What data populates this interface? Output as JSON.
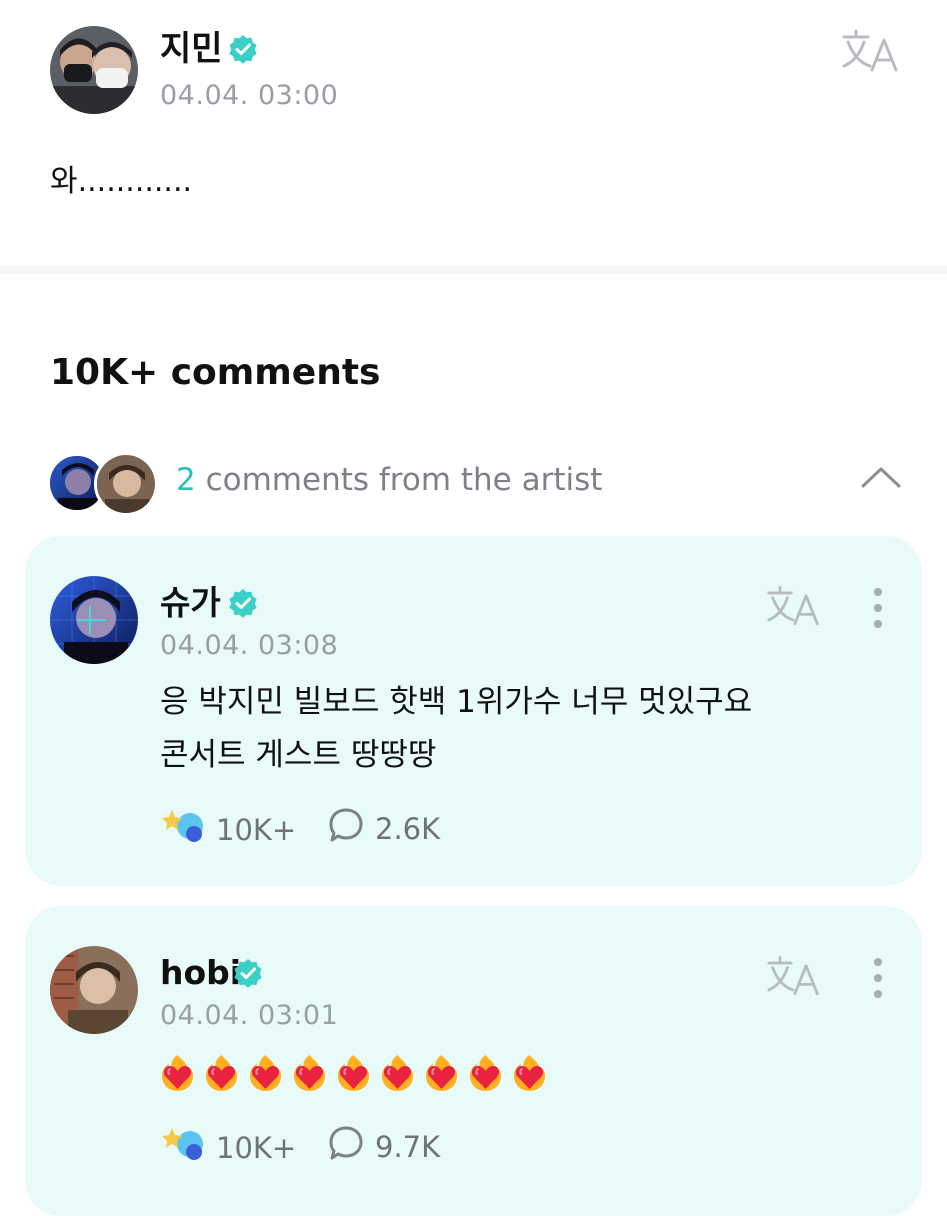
{
  "post": {
    "author": "지민",
    "timestamp": "04.04. 03:00",
    "body": "와............"
  },
  "comments_count_label": "10K+ comments",
  "artist_comments": {
    "count": "2",
    "label": " comments from the artist"
  },
  "comments": [
    {
      "author": "슈가",
      "timestamp": "04.04. 03:08",
      "lines": [
        "응 박지민 빌보드 핫백 1위가수 너무 멋있구요",
        "콘서트 게스트 땅땅땅"
      ],
      "likes": "10K+",
      "replies": "2.6K"
    },
    {
      "author": "hobi",
      "timestamp": "04.04. 03:01",
      "emoji_count": 9,
      "emoji_name": "burning-heart-emoji",
      "likes": "10K+",
      "replies": "9.7K"
    }
  ],
  "colors": {
    "accent": "#2dbfb8",
    "verified": "#3ad0c8",
    "card_bg": "#e8fbf8",
    "muted_text": "#9a9ea4"
  },
  "icons": {
    "verified": "verified-badge-icon",
    "translate": "translate-icon",
    "more": "more-vertical-icon",
    "like": "star-lightstick-icon",
    "reply": "speech-bubble-icon",
    "collapse": "chevron-up-icon"
  }
}
